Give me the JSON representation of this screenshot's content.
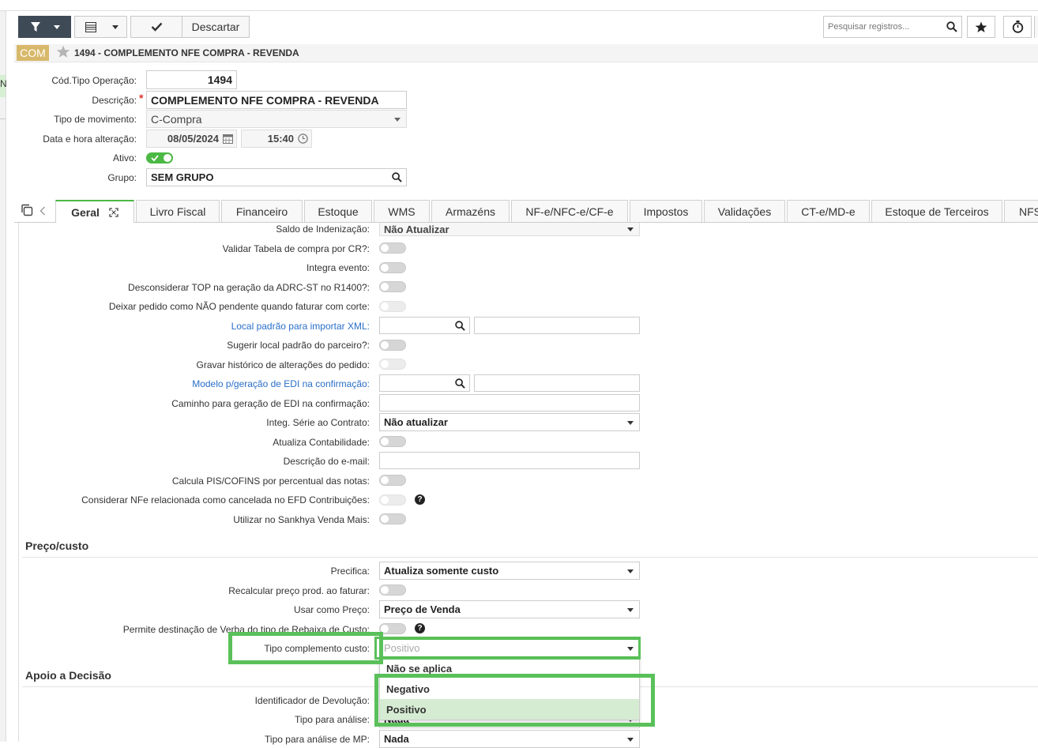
{
  "toolbar": {
    "discard_label": "Descartar",
    "search_placeholder": "Pesquisar registros..."
  },
  "header": {
    "badge": "COM",
    "title": "1494 - COMPLEMENTO NFE COMPRA - REVENDA"
  },
  "left_stub": {
    "letter": "N"
  },
  "form": {
    "cod_label": "Cód.Tipo Operação:",
    "cod_value": "1494",
    "descricao_label": "Descrição:",
    "descricao_required": "*",
    "descricao_value": "COMPLEMENTO NFE COMPRA - REVENDA",
    "tipo_mov_label": "Tipo de movimento:",
    "tipo_mov_value": "C-Compra",
    "data_label": "Data e hora alteração:",
    "data_value": "08/05/2024",
    "hora_value": "15:40",
    "ativo_label": "Ativo:",
    "ativo_on": true,
    "grupo_label": "Grupo:",
    "grupo_value": "SEM GRUPO"
  },
  "tabs": [
    "Geral",
    "Livro Fiscal",
    "Financeiro",
    "Estoque",
    "WMS",
    "Armazéns",
    "NF-e/NFC-e/CF-e",
    "Impostos",
    "Validações",
    "CT-e/MD-e",
    "Estoque de Terceiros",
    "NFS"
  ],
  "active_tab": "Geral",
  "geral": {
    "saldo_label": "Saldo de Indenização:",
    "saldo_value": "Não Atualizar",
    "validar_label": "Validar Tabela de compra por CR?:",
    "integra_label": "Integra evento:",
    "desconsiderar_label": "Desconsiderar TOP na geração da ADRC-ST no R1400?:",
    "deixar_label": "Deixar pedido como NÃO pendente quando faturar com corte:",
    "local_label": "Local padrão para importar XML:",
    "sugerir_label": "Sugerir local padrão do parceiro?:",
    "gravar_label": "Gravar histórico de alterações do pedido:",
    "modelo_label": "Modelo p/geração de EDI na confirmação:",
    "caminho_label": "Caminho para geração de EDI na confirmação:",
    "integ_label": "Integ. Série ao Contrato:",
    "integ_value": "Não atualizar",
    "atualiza_label": "Atualiza Contabilidade:",
    "email_label": "Descrição do e-mail:",
    "calcula_label": "Calcula PIS/COFINS por percentual das notas:",
    "considerar_label": "Considerar NFe relacionada como cancelada no EFD Contribuições:",
    "utilizar_label": "Utilizar no Sankhya Venda Mais:"
  },
  "preco": {
    "section": "Preço/custo",
    "precifica_label": "Precifica:",
    "precifica_value": "Atualiza somente custo",
    "recalcular_label": "Recalcular preço prod. ao faturar:",
    "usar_label": "Usar como Preço:",
    "usar_value": "Preço de Venda",
    "permite_label": "Permite destinação de Verba do tipo de Rebaixa de Custo:",
    "tipo_comp_label": "Tipo complemento custo:",
    "tipo_comp_value": "Positivo"
  },
  "apoio": {
    "section": "Apoio a Decisão",
    "ident_label": "Identificador de Devolução:",
    "tipo_analise_label": "Tipo para análise:",
    "tipo_analise_value": "Nada",
    "tipo_mp_label": "Tipo para análise de MP:",
    "tipo_mp_value": "Nada"
  },
  "dropdown": {
    "options": [
      "Não se aplica",
      "Negativo",
      "Positivo"
    ],
    "selected": "Positivo"
  },
  "colors": {
    "accent_green": "#4cb944",
    "highlight_green": "#5ac05a",
    "badge_gold": "#d8b86a",
    "toolbar_dark": "#3f4a57",
    "link_blue": "#2a6fc9"
  },
  "icons": [
    "filter-icon",
    "grid-icon",
    "check-icon",
    "search-icon",
    "star-icon",
    "stopwatch-icon",
    "calendar-icon",
    "clock-icon",
    "expand-icon",
    "copy-icon",
    "help-icon"
  ]
}
